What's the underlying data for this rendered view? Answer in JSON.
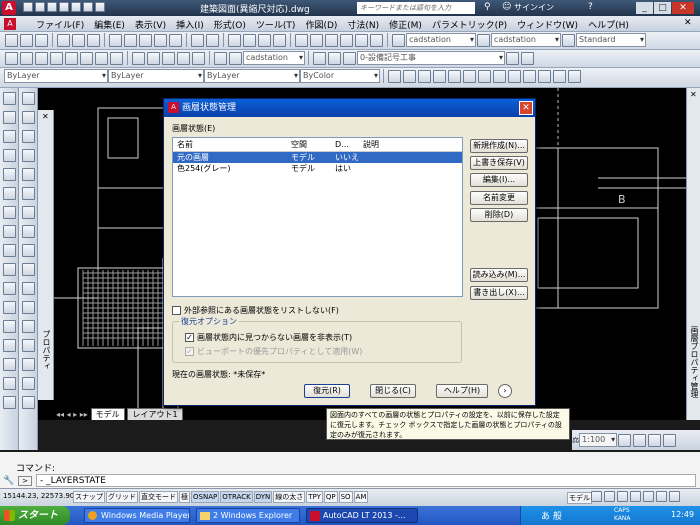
{
  "app": {
    "title": "建築図面(異縮尺対応).dwg",
    "search_placeholder": "キーワードまたは語句を入力",
    "signin": "サインイン"
  },
  "menu": [
    "ファイル(F)",
    "編集(E)",
    "表示(V)",
    "挿入(I)",
    "形式(O)",
    "ツール(T)",
    "作図(D)",
    "寸法(N)",
    "修正(M)",
    "パラメトリック(P)",
    "ウィンドウ(W)",
    "ヘルプ(H)"
  ],
  "toolbars": {
    "text_style": "cadstation",
    "dim_style": "cadstation",
    "table_style": "Standard",
    "layer": "0-設備記号工事",
    "color": "ByLayer",
    "linetype": "ByLayer",
    "lineweight": "ByLayer",
    "plotstyle": "ByColor"
  },
  "palettes": {
    "left": "プロパティ",
    "right": "画層プロパティ管理"
  },
  "dialog": {
    "title": "画層状態管理",
    "group_label": "画層状態(E)",
    "columns": [
      "名前",
      "空間",
      "D...",
      "説明"
    ],
    "rows": [
      {
        "name": "元の画層",
        "space": "モデル",
        "d": "いいえ",
        "desc": ""
      },
      {
        "name": "色254(グレー)",
        "space": "モデル",
        "d": "はい",
        "desc": ""
      }
    ],
    "buttons": {
      "new": "新規作成(N)...",
      "save": "上書き保存(V)",
      "edit": "編集(I)...",
      "rename": "名前変更",
      "delete": "削除(D)",
      "import": "読み込み(M)...",
      "export": "書き出し(X)..."
    },
    "xref_check": "外部参照にある画層状態をリストしない(F)",
    "restore_options": "復元オプション",
    "hide_new_layers": "画層状態内に見つからない画層を非表示(T)",
    "viewport_override": "ビューポートの優先プロパティとして適用(W)",
    "current_state": "現在の画層状態: *未保存*",
    "restore": "復元(R)",
    "close": "閉じる(C)",
    "help": "ヘルプ(H)"
  },
  "tooltip": "図面内のすべての画層の状態とプロパティの設定を、以前に保存した設定に復元します。チェック ボックスで指定した画層の状態とプロパティの設定のみが復元されます。",
  "tabs": [
    "モデル",
    "レイアウト1"
  ],
  "annotation_scale": "1:100",
  "command": {
    "prompt": "コマンド:",
    "input": "_LAYERSTATE"
  },
  "status": {
    "coords": "15144.23, 22573.90",
    "modes": [
      "スナップ",
      "グリッド",
      "直交モード",
      "極",
      "OSNAP",
      "OTRACK",
      "DYN",
      "線の太さ",
      "TPY",
      "QP",
      "SO",
      "AM"
    ],
    "active": [
      "OSNAP",
      "OTRACK",
      "DYN"
    ],
    "model": "モデル"
  },
  "taskbar": {
    "start": "スタート",
    "items": [
      "Windows Media Player",
      "2 Windows Explorer",
      "AutoCAD LT 2013 -..."
    ],
    "ime": "あ 般",
    "caps": "CAPS",
    "kana": "KANA",
    "time": "12:49"
  },
  "colors": {
    "accent": "#0a3fa8",
    "selection": "#316ac5",
    "taskbar": "#2456c1",
    "start": "#3c9a2f",
    "canvas": "#000000"
  }
}
